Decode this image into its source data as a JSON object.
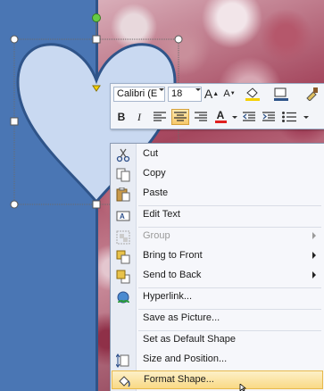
{
  "context_menu": {
    "items": [
      {
        "label": "Cut",
        "icon": "scissors-icon",
        "disabled": false,
        "submenu": false
      },
      {
        "label": "Copy",
        "icon": "copy-icon",
        "disabled": false,
        "submenu": false
      },
      {
        "label": "Paste",
        "icon": "paste-icon",
        "disabled": false,
        "submenu": false
      },
      {
        "label": "Edit Text",
        "icon": "edit-text-icon",
        "disabled": false,
        "submenu": false
      },
      {
        "label": "Group",
        "icon": "group-icon",
        "disabled": true,
        "submenu": true
      },
      {
        "label": "Bring to Front",
        "icon": "bring-front-icon",
        "disabled": false,
        "submenu": true
      },
      {
        "label": "Send to Back",
        "icon": "send-back-icon",
        "disabled": false,
        "submenu": true
      },
      {
        "label": "Hyperlink...",
        "icon": "hyperlink-icon",
        "disabled": false,
        "submenu": false
      },
      {
        "label": "Save as Picture...",
        "icon": "",
        "disabled": false,
        "submenu": false
      },
      {
        "label": "Set as Default Shape",
        "icon": "",
        "disabled": false,
        "submenu": false
      },
      {
        "label": "Size and Position...",
        "icon": "size-position-icon",
        "disabled": false,
        "submenu": false
      },
      {
        "label": "Format Shape...",
        "icon": "format-shape-icon",
        "disabled": false,
        "submenu": false,
        "highlighted": true
      }
    ]
  },
  "mini_toolbar": {
    "font_name": "Calibri (E",
    "font_size": "18",
    "grow_font_label": "A",
    "shrink_font_label": "A",
    "bold_label": "B",
    "italic_label": "I",
    "font_color_label": "A"
  },
  "colors": {
    "slide_blue": "#4a76b4",
    "heart_fill": "#c9d9f1",
    "heart_stroke": "#2f5489",
    "menu_highlight": "#f9d985",
    "font_color_red": "#e02020",
    "fill_yellow": "#f5d000"
  }
}
